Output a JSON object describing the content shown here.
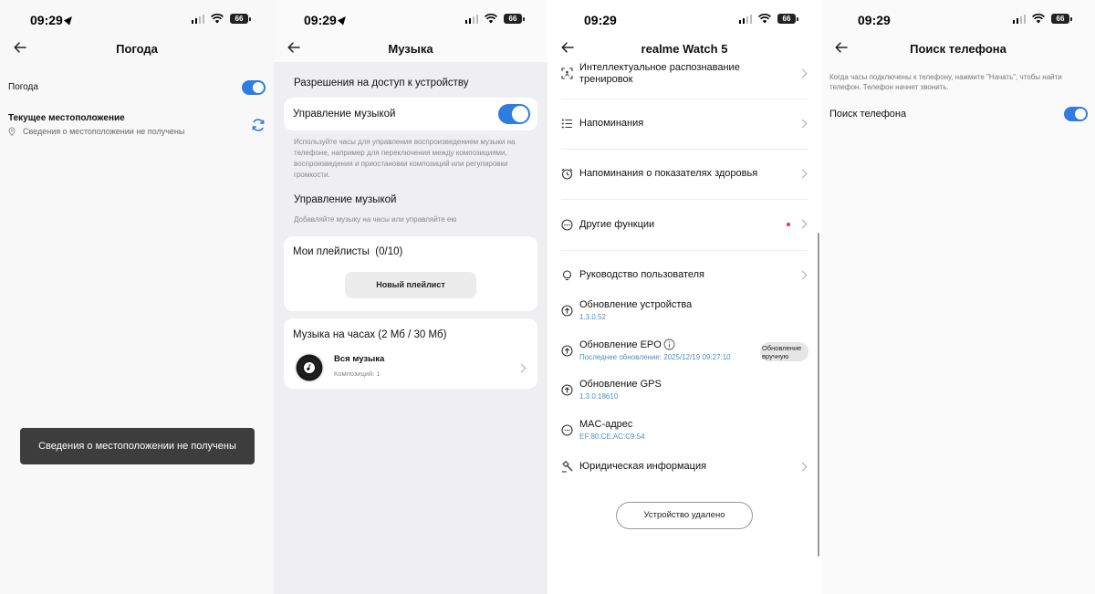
{
  "status_bars": [
    {
      "time": "09:29",
      "battery": "66"
    },
    {
      "time": "09:29",
      "battery": "66"
    },
    {
      "time": "09:29",
      "battery": "66"
    },
    {
      "time": "09:29",
      "battery": "66"
    }
  ],
  "weather_screen": {
    "title": "Погода",
    "weather_label": "Погода",
    "weather_toggle_on": true,
    "location_label": "Текущее местоположение",
    "location_status": "Сведения о местоположении не получены",
    "toast": "Сведения о местоположении не получены"
  },
  "music_screen": {
    "title": "Музыка",
    "permissions_header": "Разрешения на доступ к устройству",
    "music_control_label": "Управление музыкой",
    "music_control_toggle_on": true,
    "music_control_desc": "Используйте часы для управления воспроизведением музыки на телефоне, например для переключения между композициями, воспроизведения и приостановки композиций или регулировки громкости.",
    "music_section_header": "Управление музыкой",
    "music_section_desc": "Добавляйте музыку на часы или управляйте ею",
    "playlists_label": "Мои плейлисты",
    "playlists_count": "(0/10)",
    "new_playlist_button": "Новый плейлист",
    "watch_music_label": "Музыка на часах (2 Мб / 30 Мб)",
    "all_music_title": "Вся музыка",
    "all_music_count": "Композиций: 1"
  },
  "device_screen": {
    "title": "realme Watch 5",
    "items": [
      {
        "label": "Интеллектуальное распознавание тренировок",
        "icon": "scan-icon"
      },
      {
        "label": "Напоминания",
        "icon": "list-icon"
      },
      {
        "label": "Напоминания о показателях здоровья",
        "icon": "alarm-icon"
      },
      {
        "label": "Другие функции",
        "icon": "more-icon"
      },
      {
        "label": "Руководство пользователя",
        "icon": "bulb-icon"
      },
      {
        "label": "Обновление устройства",
        "value": "1.3.0.52",
        "icon": "update-icon"
      },
      {
        "label": "Обновление EPO",
        "value": "Последнее обновление:  2025/12/19 09:27:10",
        "icon": "update-icon",
        "pill": "Обновление вручную"
      },
      {
        "label": "Обновление GPS",
        "value": "1.3.0.18610",
        "icon": "update-icon"
      },
      {
        "label": "MAC-адрес",
        "value": "EF:80:CE:AC:C9:54",
        "icon": "mac-icon"
      },
      {
        "label": "Юридическая информация",
        "icon": "hammer-icon"
      }
    ],
    "pill_line1": "Обновление",
    "pill_line2": "вручную",
    "remove_button": "Устройство удалено",
    "colors": {
      "accent": "#2f7de1",
      "dot": "#e8334a",
      "value": "#4a90c8"
    }
  },
  "find_phone_screen": {
    "title": "Поиск телефона",
    "description": "Когда часы подключены к телефону, нажмите \"Начать\", чтобы найти телефон. Телефон начнет звонить.",
    "find_phone_label": "Поиск телефона",
    "find_phone_toggle_on": true
  }
}
